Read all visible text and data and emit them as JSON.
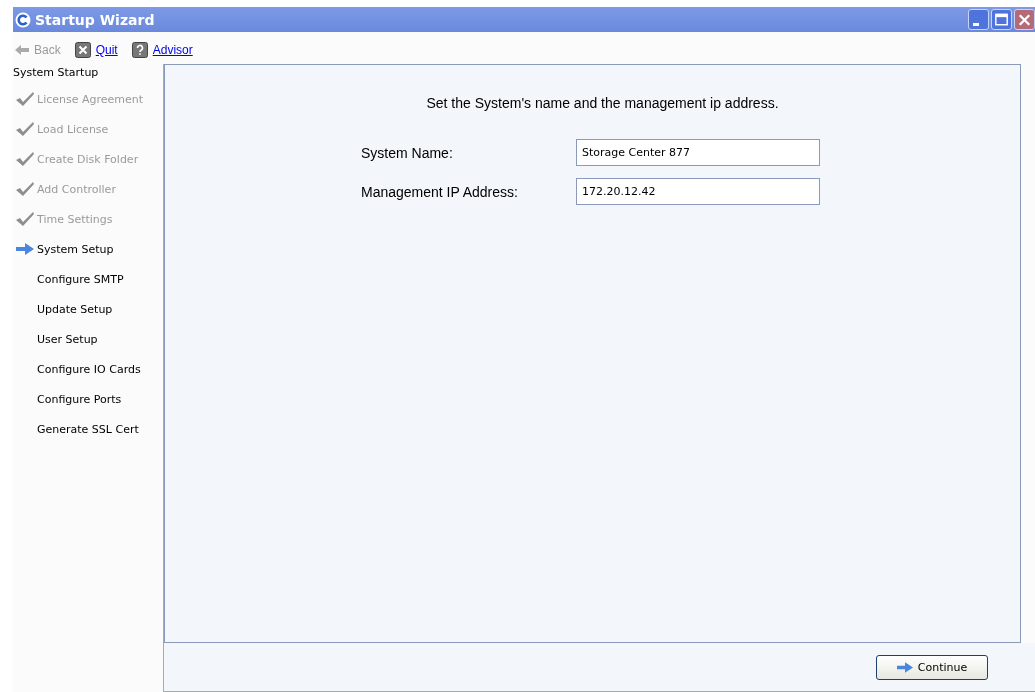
{
  "window": {
    "title": "Startup Wizard"
  },
  "toolbar": [
    {
      "kind": "back",
      "label": "Back",
      "disabled": true
    },
    {
      "kind": "quit",
      "label": "Quit",
      "disabled": false
    },
    {
      "kind": "advisor",
      "label": "Advisor",
      "disabled": false
    }
  ],
  "sidebar": {
    "heading": "System Startup",
    "steps": [
      {
        "label": "License Agreement",
        "kind": "done"
      },
      {
        "label": "Load License",
        "kind": "done"
      },
      {
        "label": "Create Disk Folder",
        "kind": "done"
      },
      {
        "label": "Add Controller",
        "kind": "done"
      },
      {
        "label": "Time Settings",
        "kind": "done"
      },
      {
        "label": "System Setup",
        "kind": "current"
      },
      {
        "label": "Configure SMTP",
        "kind": "pending"
      },
      {
        "label": "Update Setup",
        "kind": "pending"
      },
      {
        "label": "User Setup",
        "kind": "pending"
      },
      {
        "label": "Configure IO Cards",
        "kind": "pending"
      },
      {
        "label": "Configure Ports",
        "kind": "pending"
      },
      {
        "label": "Generate SSL Cert",
        "kind": "pending"
      }
    ]
  },
  "form": {
    "instruction": "Set the System's name and the management ip address.",
    "fields": [
      {
        "label": "System Name:",
        "value": "Storage Center 877"
      },
      {
        "label": "Management IP Address:",
        "value": "172.20.12.42"
      }
    ]
  },
  "buttons": [
    {
      "label": "Continue"
    }
  ]
}
